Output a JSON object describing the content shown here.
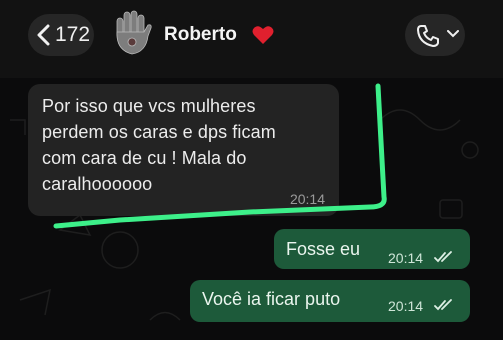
{
  "header": {
    "back_count": "172",
    "contact_name": "Roberto",
    "contact_emoji": "heart-icon",
    "avatar": "hand-icon",
    "call": "phone-icon"
  },
  "messages": [
    {
      "direction": "incoming",
      "lines": [
        "Por isso que vcs mulheres",
        "perdem os caras e dps ficam",
        "com cara de cu ! Mala do",
        "caralhoooooo"
      ],
      "time": "20:14"
    },
    {
      "direction": "outgoing",
      "text": "Fosse eu",
      "time": "20:14",
      "status": "read-double-check"
    },
    {
      "direction": "outgoing",
      "text": "Você ia ficar puto",
      "time": "20:14",
      "status": "read-double-check"
    }
  ],
  "colors": {
    "background": "#0b0b0c",
    "incoming_bubble": "#232323",
    "outgoing_bubble": "#1d5a3a",
    "highlight_stroke": "#3df08a"
  }
}
